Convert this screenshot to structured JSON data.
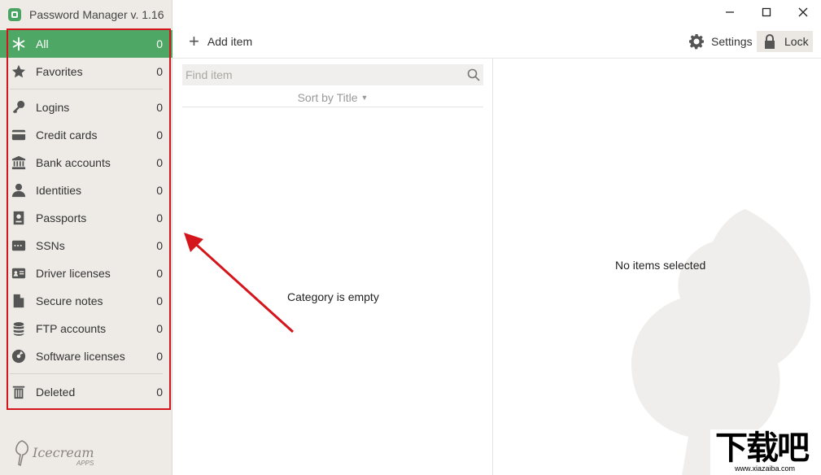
{
  "app": {
    "title": "Password Manager v. 1.16"
  },
  "sidebar": {
    "items": [
      {
        "label": "All",
        "count": "0",
        "icon": "asterisk-icon",
        "active": true
      },
      {
        "label": "Favorites",
        "count": "0",
        "icon": "star-icon"
      },
      {
        "label": "Logins",
        "count": "0",
        "icon": "key-icon"
      },
      {
        "label": "Credit cards",
        "count": "0",
        "icon": "credit-card-icon"
      },
      {
        "label": "Bank accounts",
        "count": "0",
        "icon": "bank-icon"
      },
      {
        "label": "Identities",
        "count": "0",
        "icon": "person-icon"
      },
      {
        "label": "Passports",
        "count": "0",
        "icon": "passport-icon"
      },
      {
        "label": "SSNs",
        "count": "0",
        "icon": "ssn-card-icon"
      },
      {
        "label": "Driver licenses",
        "count": "0",
        "icon": "id-card-icon"
      },
      {
        "label": "Secure notes",
        "count": "0",
        "icon": "note-icon"
      },
      {
        "label": "FTP accounts",
        "count": "0",
        "icon": "database-icon"
      },
      {
        "label": "Software licenses",
        "count": "0",
        "icon": "disc-icon"
      },
      {
        "label": "Deleted",
        "count": "0",
        "icon": "trash-icon"
      }
    ],
    "brand": {
      "name": "Icecream",
      "sub": "APPS"
    }
  },
  "toolbar": {
    "add_label": "Add item",
    "settings_label": "Settings",
    "lock_label": "Lock"
  },
  "list": {
    "search_placeholder": "Find item",
    "sort_label": "Sort by Title",
    "empty_message": "Category is empty"
  },
  "detail": {
    "empty_message": "No items selected"
  },
  "colors": {
    "accent": "#4ea765",
    "annotation": "#d4151b",
    "sidebar_bg": "#eeebe7"
  },
  "watermark": {
    "text": "下载吧",
    "url": "www.xiazaiba.com"
  }
}
